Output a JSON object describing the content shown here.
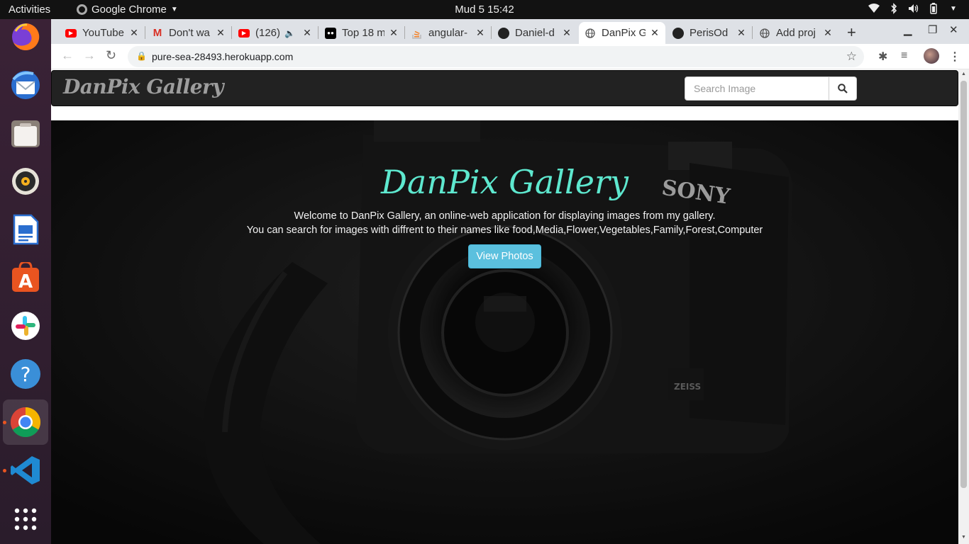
{
  "topbar": {
    "activities": "Activities",
    "app_name": "Google Chrome",
    "clock": "Mud 5  15:42"
  },
  "dock": {
    "items": [
      "firefox-icon",
      "thunderbird-icon",
      "files-icon",
      "rhythmbox-icon",
      "libreoffice-writer-icon",
      "software-center-icon",
      "slack-icon",
      "help-icon",
      "chrome-icon",
      "vscode-icon",
      "show-apps-icon"
    ]
  },
  "tabs": [
    {
      "title": "YouTube",
      "favicon": "youtube-icon"
    },
    {
      "title": "Don't wa",
      "favicon": "gmail-icon"
    },
    {
      "title": "(126)",
      "favicon": "youtube-icon"
    },
    {
      "title": "Top 18 m",
      "favicon": "medium-icon"
    },
    {
      "title": "angular-",
      "favicon": "stackoverflow-icon"
    },
    {
      "title": "Daniel-d",
      "favicon": "github-icon"
    },
    {
      "title": "DanPix G",
      "favicon": "globe-icon"
    },
    {
      "title": "PerisOd",
      "favicon": "github-icon"
    },
    {
      "title": "Add proj",
      "favicon": "globe-icon"
    }
  ],
  "address": {
    "url": "pure-sea-28493.herokuapp.com"
  },
  "page": {
    "brand": "DanPix Gallery",
    "search_placeholder": "Search Image",
    "hero_title": "DanPix Gallery",
    "hero_line1": "Welcome to DanPix Gallery, an online-web application for displaying images from my gallery.",
    "hero_line2": "You can search for images with diffrent to their names like food,Media,Flower,Vegetables,Family,Forest,Computer",
    "view_button": "View Photos",
    "camera_brand": "SONY",
    "lens_brand": "ZEISS"
  },
  "colors": {
    "accent_teal": "#5ee8cf",
    "info_button": "#5bc0de",
    "navbar_bg": "#222222"
  }
}
